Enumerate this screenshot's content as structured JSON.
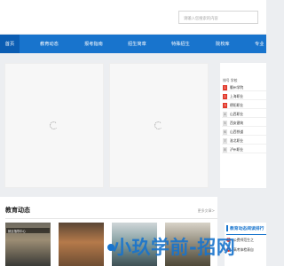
{
  "search": {
    "placeholder": "请输入您搜索的内容"
  },
  "nav": [
    {
      "label": "首页"
    },
    {
      "label": "教育动态"
    },
    {
      "label": "报考指南"
    },
    {
      "label": "招生简章"
    },
    {
      "label": "特殊招生"
    },
    {
      "label": "院校库"
    },
    {
      "label": "专业"
    }
  ],
  "ranking": {
    "header": "排号  学校",
    "rows": [
      {
        "num": "1",
        "name": "衢州学院"
      },
      {
        "num": "2",
        "name": "上海职业"
      },
      {
        "num": "3",
        "name": "德阳职业"
      },
      {
        "num": "4",
        "name": "山西职业"
      },
      {
        "num": "5",
        "name": "西安建筑"
      },
      {
        "num": "6",
        "name": "山西铁道"
      },
      {
        "num": "7",
        "name": "淮北职业"
      },
      {
        "num": "8",
        "name": "泸州职业"
      }
    ]
  },
  "section": {
    "title": "教育动态",
    "more": "更多文章>"
  },
  "news": [
    {
      "caption": "就业指导中心"
    }
  ],
  "hot": {
    "title": "教育动态阅读排行",
    "items": [
      {
        "num": "1",
        "text": "公费师范生之"
      },
      {
        "num": "2",
        "text": "高考体检表自"
      }
    ]
  },
  "watermark": "小玖学前-招网",
  "colors": {
    "brand_blue": "#1874cd",
    "hot_red": "#e23a2c"
  }
}
